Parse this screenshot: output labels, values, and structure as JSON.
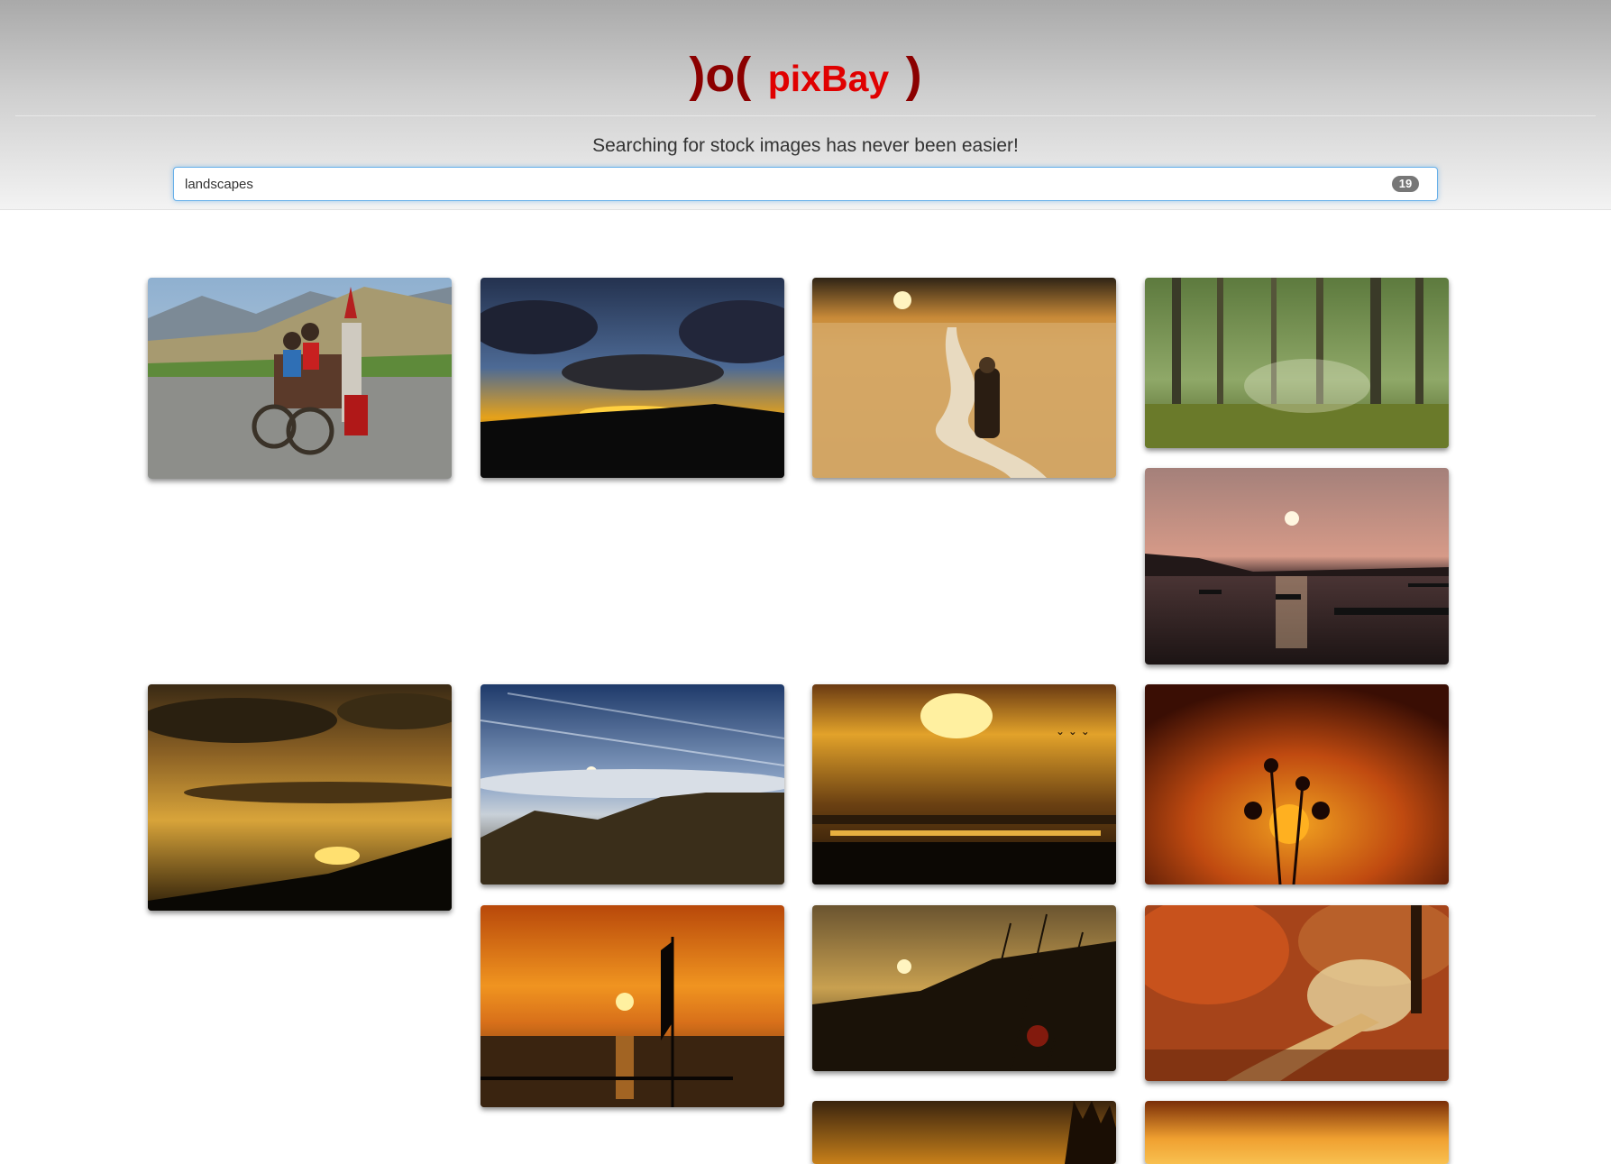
{
  "header": {
    "logo_left": ")o(",
    "logo_brand": "pixBay",
    "logo_right": ")",
    "tagline": "Searching for stock images has never been easier!"
  },
  "search": {
    "value": "landscapes",
    "result_count": "19"
  },
  "gallery": [
    {
      "subject": "horse cart with children in mountain valley"
    },
    {
      "subject": "sunset over dark hills with dramatic clouds"
    },
    {
      "subject": "monk walking on path through golden field"
    },
    {
      "subject": "sunlit green forest"
    },
    {
      "subject": "boats on lake at sunset"
    },
    {
      "subject": "golden sunset clouds over hillside"
    },
    {
      "subject": "sun above clouds from mountain top"
    },
    {
      "subject": "sunset over lake with flying birds"
    },
    {
      "subject": "plant silhouette against orange sunset"
    },
    {
      "subject": "sunset over sea with flag"
    },
    {
      "subject": "grass silhouette at sunset"
    },
    {
      "subject": "autumn forest path"
    },
    {
      "subject": "sunset over trees (partially visible)"
    },
    {
      "subject": "orange sky (partially visible)"
    }
  ]
}
